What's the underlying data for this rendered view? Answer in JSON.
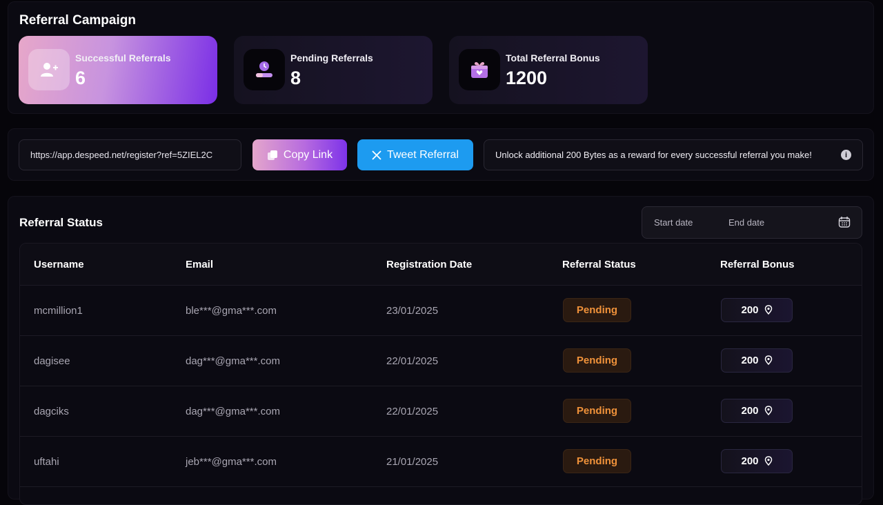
{
  "campaign": {
    "title": "Referral Campaign",
    "stats": [
      {
        "label": "Successful Referrals",
        "value": "6",
        "icon": "add-user-icon"
      },
      {
        "label": "Pending Referrals",
        "value": "8",
        "icon": "pending-clock-icon"
      },
      {
        "label": "Total Referral Bonus",
        "value": "1200",
        "icon": "gift-icon"
      }
    ]
  },
  "link": {
    "url": "https://app.despeed.net/register?ref=5ZIEL2C",
    "copy_label": "Copy Link",
    "tweet_label": "Tweet Referral",
    "info": "Unlock additional 200 Bytes as a reward for every successful referral you make!"
  },
  "status": {
    "title": "Referral Status",
    "date_start_placeholder": "Start date",
    "date_end_placeholder": "End date",
    "columns": [
      "Username",
      "Email",
      "Registration Date",
      "Referral Status",
      "Referral Bonus"
    ],
    "rows": [
      {
        "username": "mcmillion1",
        "email": "ble***@gma***.com",
        "date": "23/01/2025",
        "status": "Pending",
        "bonus": "200"
      },
      {
        "username": "dagisee",
        "email": "dag***@gma***.com",
        "date": "22/01/2025",
        "status": "Pending",
        "bonus": "200"
      },
      {
        "username": "dagciks",
        "email": "dag***@gma***.com",
        "date": "22/01/2025",
        "status": "Pending",
        "bonus": "200"
      },
      {
        "username": "uftahi",
        "email": "jeb***@gma***.com",
        "date": "21/01/2025",
        "status": "Pending",
        "bonus": "200"
      }
    ]
  },
  "colors": {
    "accent_purple": "#7a2ee6",
    "accent_pink": "#e7a7c9",
    "twitter_blue": "#1d9bf0",
    "pending_orange": "#f0923a"
  }
}
